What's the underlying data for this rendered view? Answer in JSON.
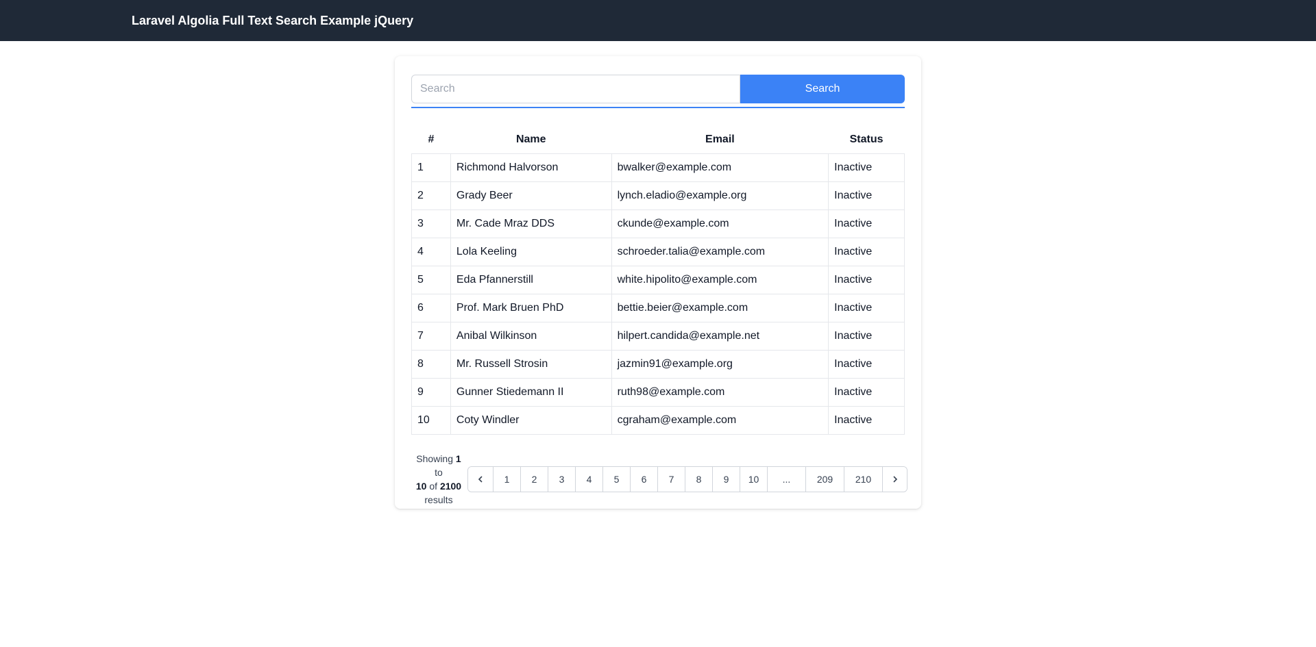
{
  "header": {
    "title": "Laravel Algolia Full Text Search Example jQuery"
  },
  "search": {
    "placeholder": "Search",
    "value": "",
    "button_label": "Search"
  },
  "table": {
    "columns": [
      "#",
      "Name",
      "Email",
      "Status"
    ],
    "rows": [
      [
        "1",
        "Richmond Halvorson",
        "bwalker@example.com",
        "Inactive"
      ],
      [
        "2",
        "Grady Beer",
        "lynch.eladio@example.org",
        "Inactive"
      ],
      [
        "3",
        "Mr. Cade Mraz DDS",
        "ckunde@example.com",
        "Inactive"
      ],
      [
        "4",
        "Lola Keeling",
        "schroeder.talia@example.com",
        "Inactive"
      ],
      [
        "5",
        "Eda Pfannerstill",
        "white.hipolito@example.com",
        "Inactive"
      ],
      [
        "6",
        "Prof. Mark Bruen PhD",
        "bettie.beier@example.com",
        "Inactive"
      ],
      [
        "7",
        "Anibal Wilkinson",
        "hilpert.candida@example.net",
        "Inactive"
      ],
      [
        "8",
        "Mr. Russell Strosin",
        "jazmin91@example.org",
        "Inactive"
      ],
      [
        "9",
        "Gunner Stiedemann II",
        "ruth98@example.com",
        "Inactive"
      ],
      [
        "10",
        "Coty Windler",
        "cgraham@example.com",
        "Inactive"
      ]
    ]
  },
  "pagination": {
    "showing_prefix": "Showing",
    "from": "1",
    "to_word": "to",
    "to": "10",
    "of_word": "of",
    "total": "2100",
    "results_word": "results",
    "pages": [
      "1",
      "2",
      "3",
      "4",
      "5",
      "6",
      "7",
      "8",
      "9",
      "10",
      "...",
      "209",
      "210"
    ],
    "prev_icon": "chevron-left-icon",
    "next_icon": "chevron-right-icon"
  },
  "colors": {
    "navbar": "#1f2937",
    "accent": "#3b82f6"
  }
}
